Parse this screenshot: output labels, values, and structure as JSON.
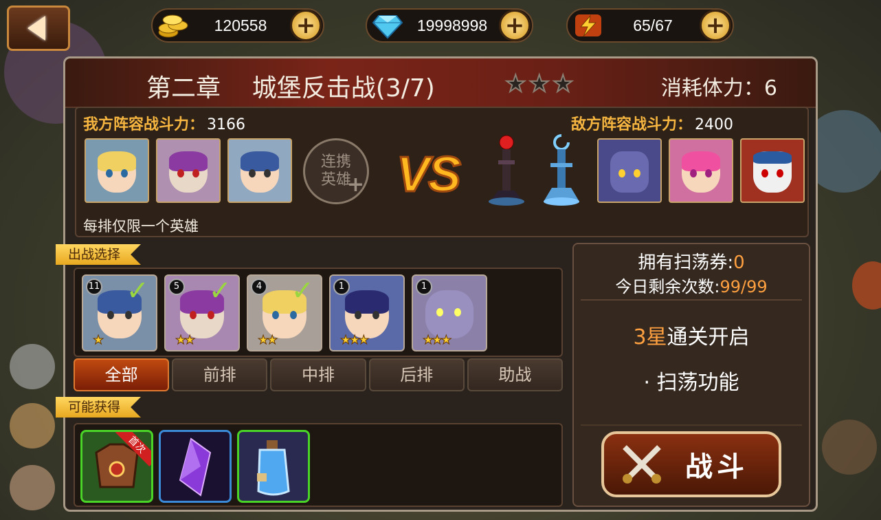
{
  "top_bar": {
    "back_icon": "back-arrow-icon",
    "resources": [
      {
        "name": "gold",
        "icon": "gold-coins-icon",
        "value": "120558"
      },
      {
        "name": "diamond",
        "icon": "diamond-icon",
        "value": "19998998"
      },
      {
        "name": "stamina",
        "icon": "lightning-icon",
        "value": "65/67"
      }
    ],
    "plus_glyph": "+"
  },
  "stage": {
    "title": "第二章    城堡反击战(3/7)",
    "stars_total": 3,
    "stars_earned": 0,
    "cost_label": "消耗体力：6"
  },
  "lineup": {
    "my_power_label": "我方阵容战斗力：",
    "my_power_value": "3166",
    "enemy_power_label": "敌方阵容战斗力：",
    "enemy_power_value": "2400",
    "my_heroes": [
      {
        "name": "blonde-goggles-hero"
      },
      {
        "name": "purple-hair-heroine"
      },
      {
        "name": "blue-hair-hero"
      }
    ],
    "locked_slot_text": "连携英雄",
    "locked_plus": "+",
    "vs_text": "VS",
    "enemy_towers": [
      {
        "name": "dark-tower"
      },
      {
        "name": "ice-tower"
      }
    ],
    "enemy_heroes": [
      {
        "name": "armored-golem"
      },
      {
        "name": "pink-hair-heroine"
      },
      {
        "name": "skull-mask-beast"
      }
    ],
    "note": "每排仅限一个英雄"
  },
  "battle_select": {
    "tag": "出战选择",
    "cards": [
      {
        "level": "11",
        "stars": 1,
        "selected": true,
        "name": "blue-hair-hero"
      },
      {
        "level": "5",
        "stars": 2,
        "selected": true,
        "name": "purple-hair-heroine"
      },
      {
        "level": "4",
        "stars": 2,
        "selected": true,
        "name": "blonde-goggles-hero"
      },
      {
        "level": "1",
        "stars": 3,
        "selected": false,
        "name": "police-hat-hero"
      },
      {
        "level": "1",
        "stars": 3,
        "selected": false,
        "name": "purple-ogre"
      }
    ],
    "tabs": [
      "全部",
      "前排",
      "中排",
      "后排",
      "助战"
    ],
    "active_tab": "全部"
  },
  "rewards": {
    "tag": "可能获得",
    "items": [
      {
        "name": "armor-item",
        "border": "#4ad428",
        "ribbon": "首次"
      },
      {
        "name": "purple-crystal-item",
        "border": "#3a8ad8",
        "ribbon": ""
      },
      {
        "name": "blue-potion-item",
        "border": "#4ad428",
        "ribbon": ""
      }
    ]
  },
  "sweep": {
    "tickets_label": "拥有扫荡券:",
    "tickets_value": "0",
    "remaining_label": "今日剩余次数:",
    "remaining_value": "99/99",
    "unlock_stars": "3星",
    "unlock_text": "通关开启",
    "feature_text": "· 扫荡功能",
    "fight_label": "战斗",
    "fight_icon": "crossed-swords-icon"
  },
  "colors": {
    "accent_orange": "#ffa040",
    "gold": "#f7b640",
    "panel": "#2a221c"
  }
}
